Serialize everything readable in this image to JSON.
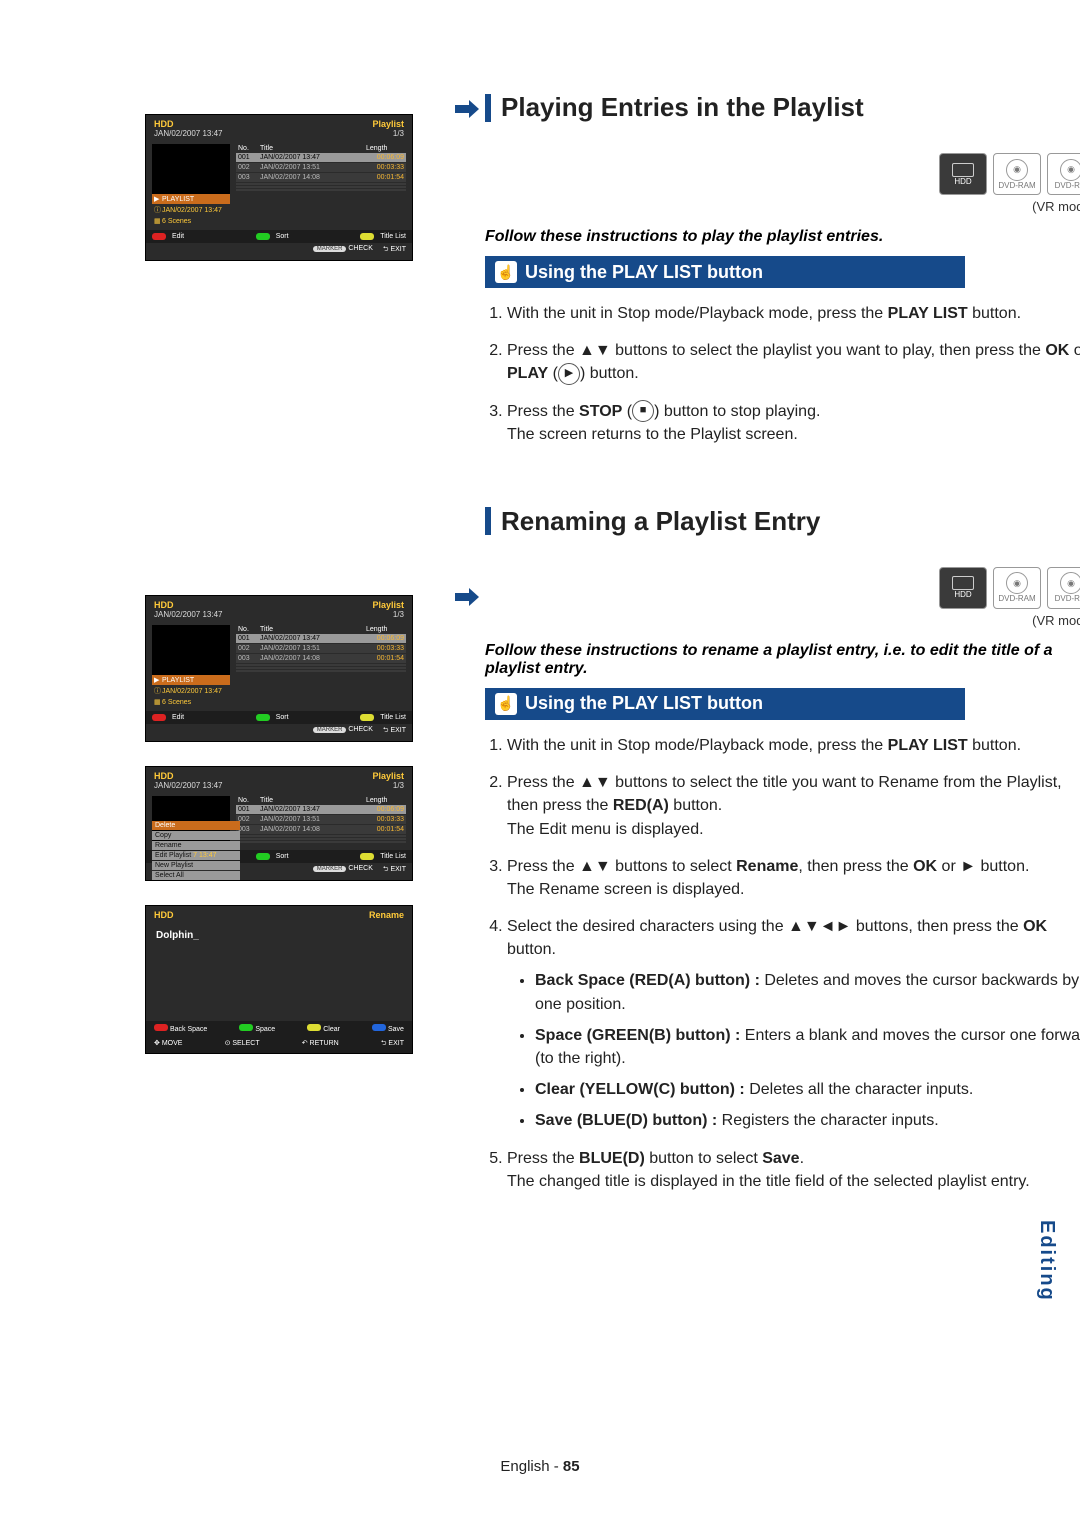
{
  "page": {
    "footer_lang": "English",
    "footer_dash": " - ",
    "footer_num": "85"
  },
  "side_tab": "Editing",
  "osd_common": {
    "device": "HDD",
    "mode": "Playlist",
    "timestamp": "JAN/02/2007 13:47",
    "page_ind": "1/3",
    "col_no": "No.",
    "col_title": "Title",
    "col_length": "Length",
    "rows": [
      {
        "no": "001",
        "title": "JAN/02/2007 13:47",
        "len": "00:06:09"
      },
      {
        "no": "002",
        "title": "JAN/02/2007 13:51",
        "len": "00:03:33"
      },
      {
        "no": "003",
        "title": "JAN/02/2007 14:08",
        "len": "00:01:54"
      }
    ],
    "side_playlist": "PLAYLIST",
    "side_time": "JAN/02/2007 13:47",
    "side_scenes": "6 Scenes",
    "foot_edit": "Edit",
    "foot_sort": "Sort",
    "foot_titlelist": "Title List",
    "foot_marker": "MARKER",
    "foot_check": "CHECK",
    "foot_exit": "EXIT"
  },
  "edit_menu": {
    "items": [
      "Delete",
      "Copy",
      "Rename",
      "Edit Playlist",
      "New Playlist",
      "Select All"
    ],
    "trail": "7 13:47"
  },
  "rename_osd": {
    "device": "HDD",
    "mode": "Rename",
    "title_text": "Dolphin_",
    "f1": [
      {
        "color": "red",
        "label": "Back Space"
      },
      {
        "color": "green",
        "label": "Space"
      },
      {
        "color": "yellow",
        "label": "Clear"
      },
      {
        "color": "blue",
        "label": "Save"
      }
    ],
    "f2_move": "MOVE",
    "f2_select": "SELECT",
    "f2_return": "RETURN",
    "f2_exit": "EXIT"
  },
  "badges": {
    "hdd": "HDD",
    "ram": "DVD-RAM",
    "rw": "DVD-RW"
  },
  "sec1": {
    "heading": "Playing Entries in the Playlist",
    "vr": "(VR mode)",
    "lead": "Follow these instructions to play the playlist entries.",
    "band": "Using the PLAY LIST button",
    "s1a": "With the unit in Stop mode/Playback mode, press the ",
    "s1b": "PLAY LIST",
    "s1c": " button.",
    "s2a": "Press the ▲▼ buttons to select the playlist you want to play, then press the ",
    "s2b": "OK",
    "s2c": " or ",
    "s2d": "PLAY",
    "s2e": " (",
    "s2f": ") button.",
    "s3a": "Press the ",
    "s3b": "STOP",
    "s3c": " (",
    "s3d": ") button to stop playing.",
    "s3e": "The screen returns to the Playlist screen."
  },
  "sec2": {
    "heading": "Renaming a Playlist Entry",
    "vr": "(VR mode)",
    "lead": "Follow these instructions to rename a playlist entry, i.e. to edit the title of a playlist entry.",
    "band": "Using the PLAY LIST button",
    "s1a": "With the unit in Stop mode/Playback mode, press the ",
    "s1b": "PLAY LIST",
    "s1c": " button.",
    "s2a": "Press the ▲▼ buttons to select the title you want to Rename from the Playlist, then press the ",
    "s2b": "RED(A)",
    "s2c": " button.",
    "s2d": "The Edit menu is displayed.",
    "s3a": "Press the ▲▼ buttons to select ",
    "s3b": "Rename",
    "s3c": ", then press the ",
    "s3d": "OK",
    "s3e": " or ► button.",
    "s3f": "The Rename screen is displayed.",
    "s4a": "Select the desired characters using the ▲▼◄► buttons, then press the ",
    "s4b": "OK",
    "s4c": " button.",
    "b1a": "Back Space (RED(A) button) : ",
    "b1b": "Deletes and moves the cursor backwards by one position.",
    "b2a": "Space (GREEN(B) button) : ",
    "b2b": "Enters a blank and moves the cursor one forward (to the right).",
    "b3a": "Clear (YELLOW(C) button) : ",
    "b3b": "Deletes all the character inputs.",
    "b4a": "Save (BLUE(D) button) : ",
    "b4b": "Registers the character inputs.",
    "s5a": "Press the ",
    "s5b": "BLUE(D)",
    "s5c": " button to select ",
    "s5d": "Save",
    "s5e": ".",
    "s5f": "The changed title is displayed in the title field of the selected playlist entry."
  }
}
